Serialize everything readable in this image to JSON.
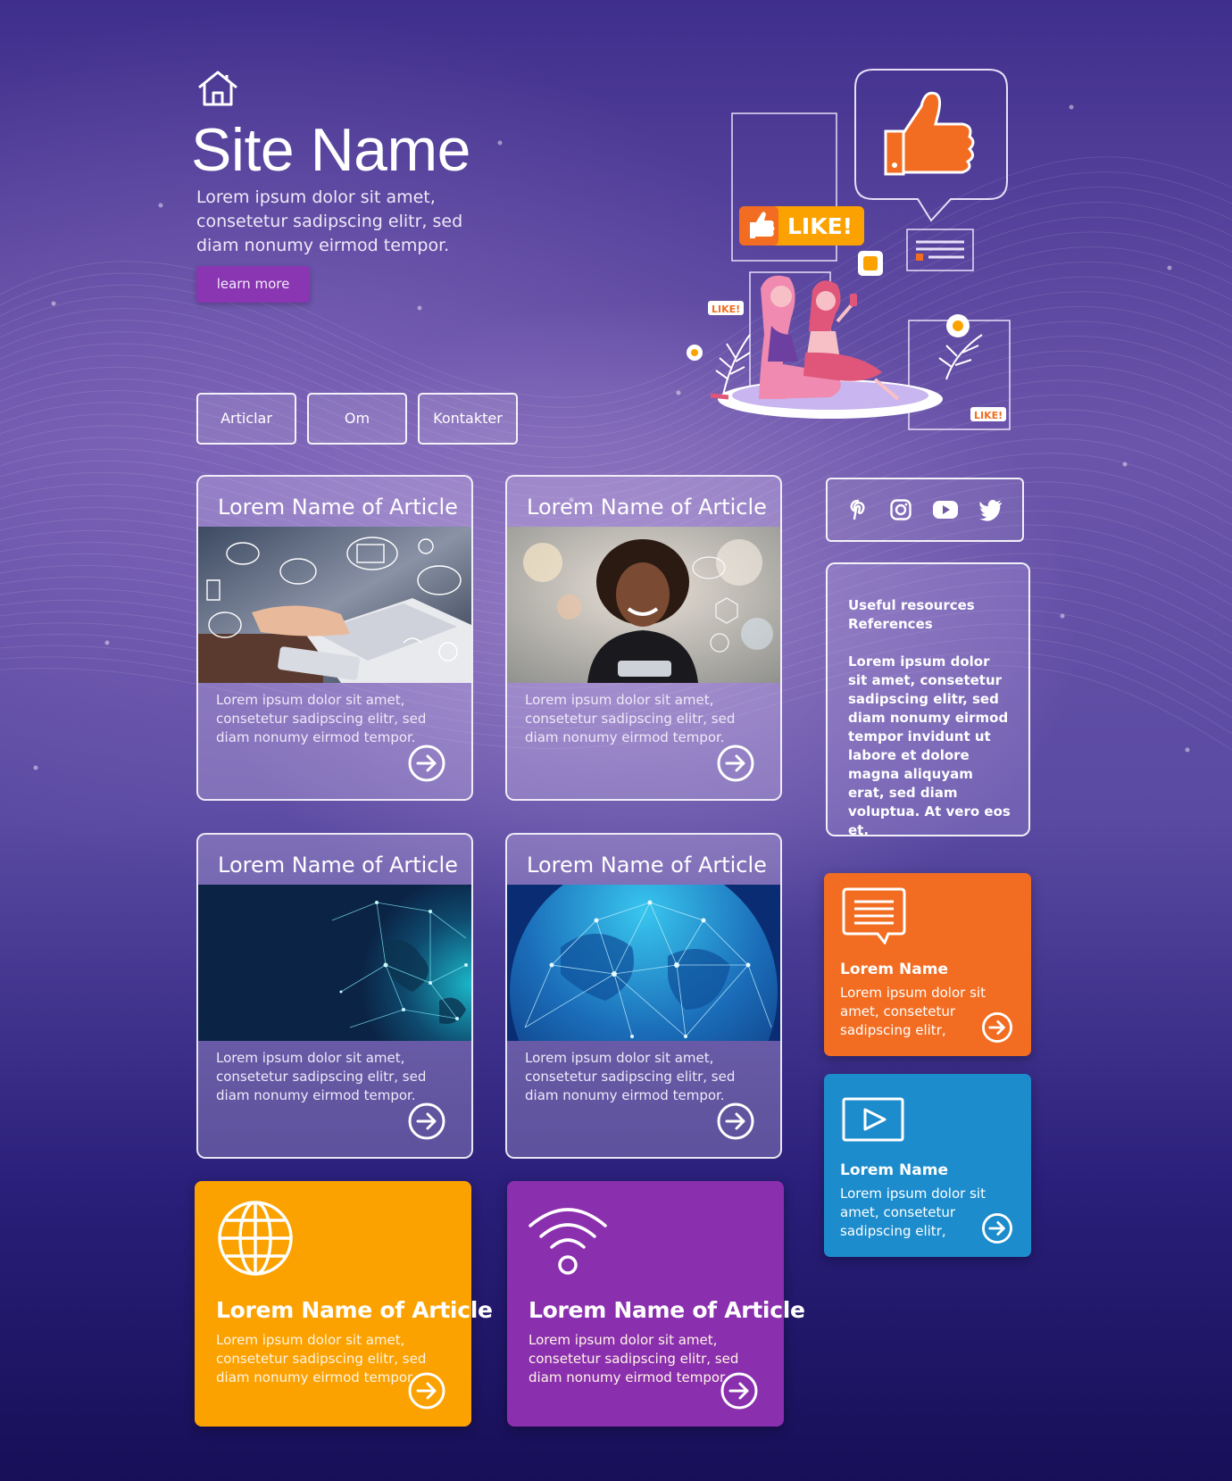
{
  "header": {
    "site_name": "Site Name",
    "intro": "Lorem ipsum dolor sit amet, consetetur sadipscing elitr, sed diam nonumy eirmod tempor.",
    "learn_more": "learn more"
  },
  "nav": {
    "items": [
      {
        "label": "Articlar"
      },
      {
        "label": "Om"
      },
      {
        "label": "Kontakter"
      }
    ]
  },
  "illustration": {
    "like_badge": "LIKE!",
    "small_badge_1": "LIKE!",
    "small_badge_2": "LIKE!"
  },
  "articles": [
    {
      "title": "Lorem Name of Article",
      "text": "Lorem ipsum dolor sit amet, consetetur sadipscing elitr, sed diam nonumy eirmod tempor.",
      "image": "laptop-social-icons"
    },
    {
      "title": "Lorem Name of Article",
      "text": "Lorem ipsum dolor sit amet, consetetur sadipscing elitr, sed diam nonumy eirmod tempor.",
      "image": "smiling-woman"
    },
    {
      "title": "Lorem Name of Article",
      "text": "Lorem ipsum dolor sit amet, consetetur sadipscing elitr, sed diam nonumy eirmod tempor.",
      "image": "globe-network-dark"
    },
    {
      "title": "Lorem Name of Article",
      "text": "Lorem ipsum dolor sit amet, consetetur sadipscing elitr, sed diam nonumy eirmod tempor.",
      "image": "globe-network-blue"
    }
  ],
  "color_cards": [
    {
      "title": "Lorem Name of Article",
      "text": "Lorem ipsum dolor sit amet, consetetur sadipscing elitr, sed diam nonumy eirmod tempor.",
      "icon": "globe-icon",
      "color": "#fba200"
    },
    {
      "title": "Lorem Name of Article",
      "text": "Lorem ipsum dolor sit amet, consetetur sadipscing elitr, sed diam nonumy eirmod tempor.",
      "icon": "wifi-icon",
      "color": "#8a2fae"
    }
  ],
  "social": {
    "icons": [
      "pinterest-icon",
      "instagram-icon",
      "youtube-icon",
      "twitter-icon"
    ]
  },
  "resources": {
    "heading_line1": "Useful resources",
    "heading_line2": "References",
    "body": "Lorem ipsum dolor sit amet, consetetur sadipscing elitr, sed diam nonumy eirmod tempor invidunt ut labore et dolore magna aliquyam erat, sed diam voluptua. At vero eos et."
  },
  "side_cards": [
    {
      "title": "Lorem Name",
      "text": "Lorem ipsum dolor sit amet, consetetur sadipscing elitr,",
      "icon": "chat-icon",
      "color": "#f26d22"
    },
    {
      "title": "Lorem Name",
      "text": "Lorem ipsum dolor sit amet, consetetur sadipscing elitr,",
      "icon": "play-icon",
      "color": "#1d8ccc"
    }
  ]
}
